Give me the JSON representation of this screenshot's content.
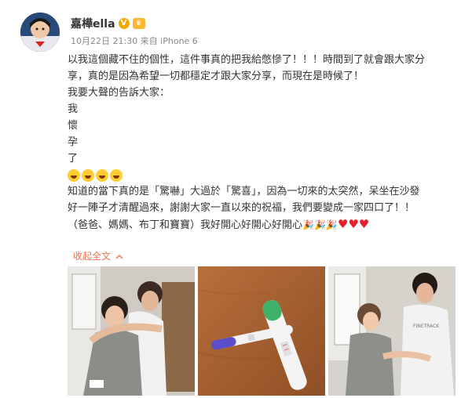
{
  "user": {
    "name": "嘉樺ella",
    "verified_icon": "v-badge-icon",
    "member_icon": "member-crown-icon"
  },
  "post": {
    "meta": "10月22日 21:30 来自 iPhone 6",
    "lines": [
      "以我這個藏不住的個性，這件事真的把我給憋慘了！！！時間到了就會跟大家分",
      "享，真的是因為希望一切都穩定才跟大家分享，而現在是時候了！",
      "我要大聲的告訴大家：",
      "我",
      "懷",
      "孕",
      "了"
    ],
    "emoji_count": 4,
    "lines2": [
      "知道的當下真的是「驚嚇」大過於「驚喜」，因為一切來的太突然，呆坐在沙發",
      "好一陣子才清醒過來，謝謝大家一直以來的祝福，我們要變成一家四口了！！",
      "（爸爸、媽媽、布丁和寶寶）我好開心好開心好開心"
    ],
    "collapse_label": "收起全文",
    "collapse_icon": "chevron-up-icon"
  },
  "colors": {
    "link": "#eb7350",
    "meta": "#888888",
    "heart": "#e5202c"
  }
}
